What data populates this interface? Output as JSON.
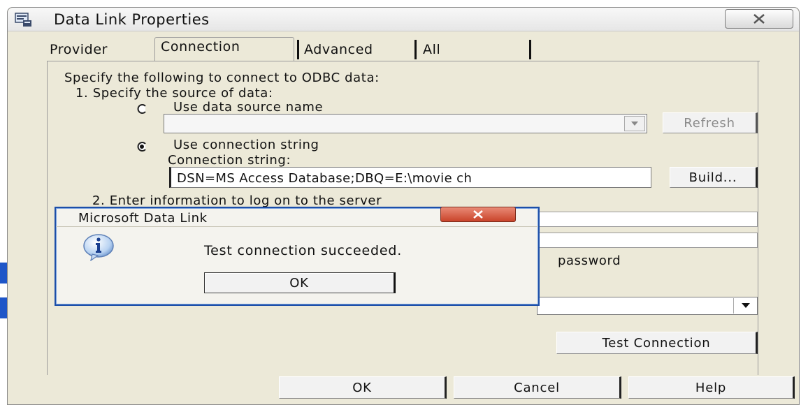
{
  "window": {
    "title": "Data Link Properties"
  },
  "tabs": [
    {
      "label": "Provider"
    },
    {
      "label": "Connection"
    },
    {
      "label": "Advanced"
    },
    {
      "label": "All"
    }
  ],
  "connection": {
    "intro": "Specify the following to connect to ODBC data:",
    "step1": "1. Specify the source of data:",
    "use_dsn_label": "Use data source name",
    "dsn_value": "",
    "refresh_label": "Refresh",
    "use_connstr_label": "Use connection string",
    "connstr_caption": "Connection string:",
    "connstr_value": "DSN=MS Access Database;DBQ=E:\\movie ch",
    "build_label": "Build...",
    "step2": "2. Enter information to log on to the server",
    "password_fragment": "password",
    "test_connection_label": "Test Connection"
  },
  "footer": {
    "ok_label": "OK",
    "cancel_label": "Cancel",
    "help_label": "Help"
  },
  "popup": {
    "title": "Microsoft Data Link",
    "message": "Test connection succeeded.",
    "ok_label": "OK",
    "icon": "info-icon"
  },
  "colors": {
    "popup_border": "#1c4ea8",
    "close_red": "#c9432a",
    "dialog_bg": "#ece9d8"
  }
}
